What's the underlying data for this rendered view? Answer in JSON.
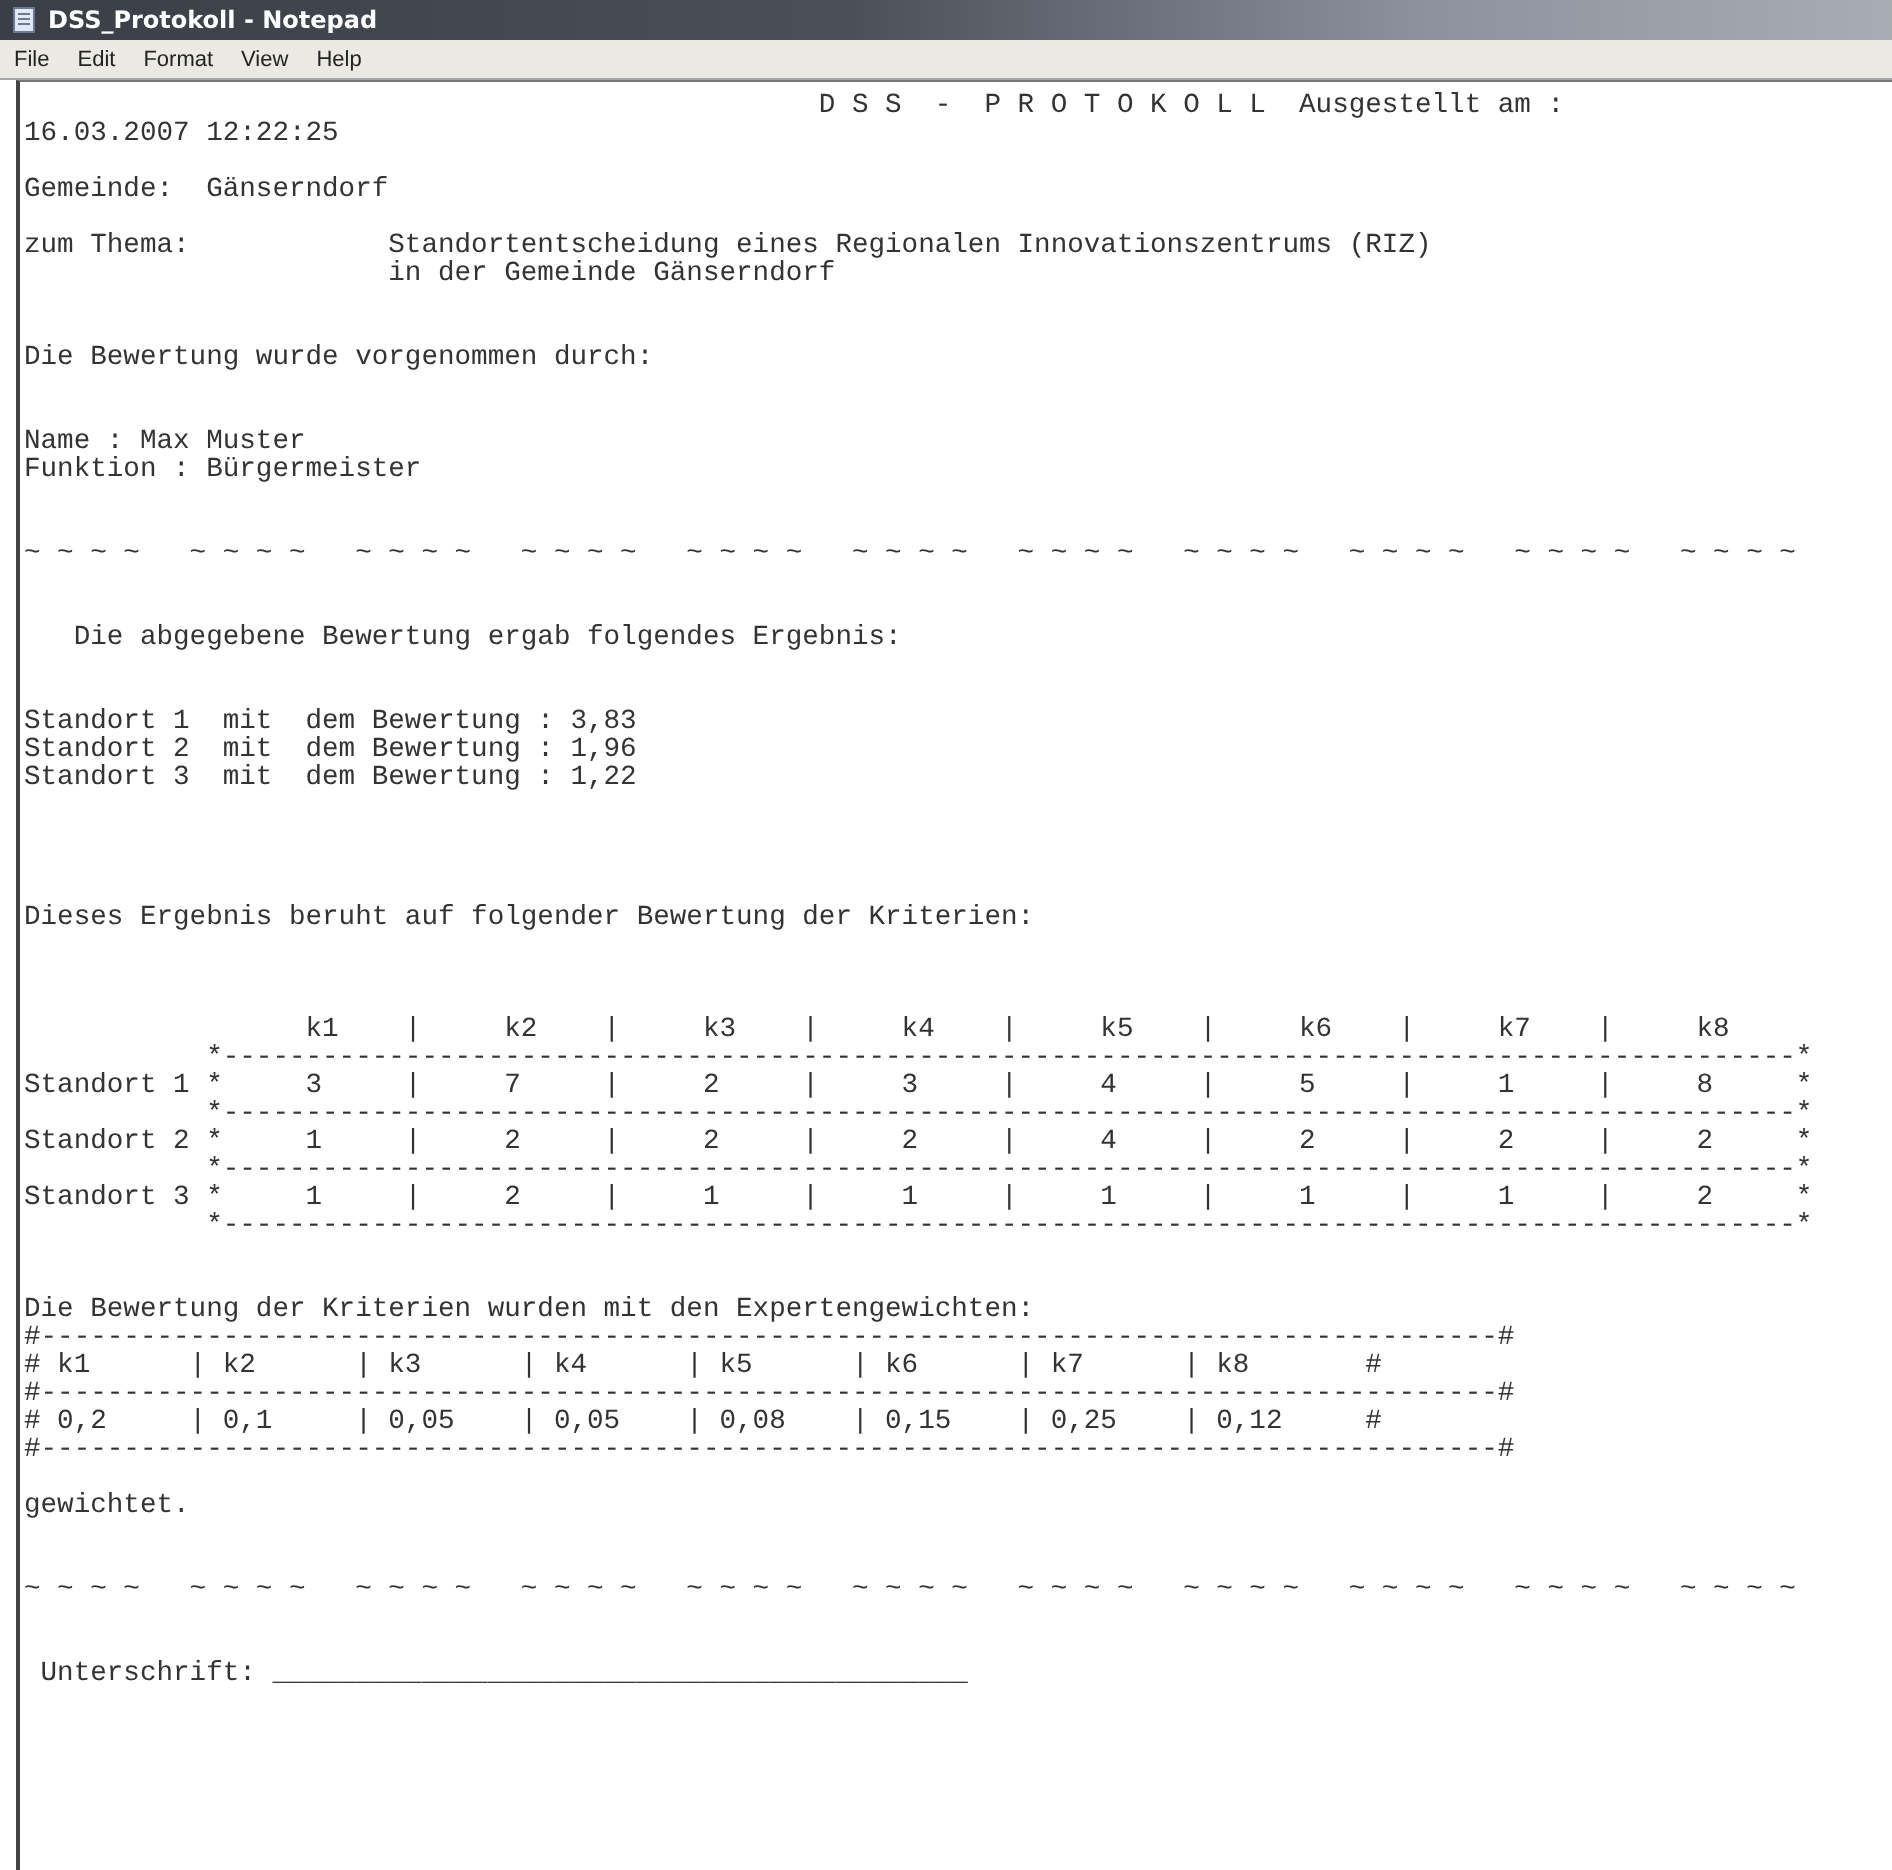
{
  "window": {
    "title": "DSS_Protokoll - Notepad"
  },
  "menu": [
    "File",
    "Edit",
    "Format",
    "View",
    "Help"
  ],
  "document": {
    "text": "                                                D S S  -  P R O T O K O L L  Ausgestellt am :\n16.03.2007 12:22:25\n\nGemeinde:  Gänserndorf\n\nzum Thema:            Standortentscheidung eines Regionalen Innovationszentrums (RIZ)\n                      in der Gemeinde Gänserndorf\n\n\nDie Bewertung wurde vorgenommen durch:\n\n\nName : Max Muster\nFunktion : Bürgermeister\n\n\n~ ~ ~ ~   ~ ~ ~ ~   ~ ~ ~ ~   ~ ~ ~ ~   ~ ~ ~ ~   ~ ~ ~ ~   ~ ~ ~ ~   ~ ~ ~ ~   ~ ~ ~ ~   ~ ~ ~ ~   ~ ~ ~ ~\n\n\n   Die abgegebene Bewertung ergab folgendes Ergebnis:\n\n\nStandort 1  mit  dem Bewertung : 3,83\nStandort 2  mit  dem Bewertung : 1,96\nStandort 3  mit  dem Bewertung : 1,22\n\n\n\n\nDieses Ergebnis beruht auf folgender Bewertung der Kriterien:\n\n\n\n                 k1    |     k2    |     k3    |     k4    |     k5    |     k6    |     k7    |     k8\n           *-----------------------------------------------------------------------------------------------*\nStandort 1 *     3     |     7     |     2     |     3     |     4     |     5     |     1     |     8     *\n           *-----------------------------------------------------------------------------------------------*\nStandort 2 *     1     |     2     |     2     |     2     |     4     |     2     |     2     |     2     *\n           *-----------------------------------------------------------------------------------------------*\nStandort 3 *     1     |     2     |     1     |     1     |     1     |     1     |     1     |     2     *\n           *-----------------------------------------------------------------------------------------------*\n\n\nDie Bewertung der Kriterien wurden mit den Expertengewichten:\n#----------------------------------------------------------------------------------------#\n# k1      | k2      | k3      | k4      | k5      | k6      | k7      | k8       #\n#----------------------------------------------------------------------------------------#\n# 0,2     | 0,1     | 0,05    | 0,05    | 0,08    | 0,15    | 0,25    | 0,12     #\n#----------------------------------------------------------------------------------------#\n\ngewichtet.\n\n\n~ ~ ~ ~   ~ ~ ~ ~   ~ ~ ~ ~   ~ ~ ~ ~   ~ ~ ~ ~   ~ ~ ~ ~   ~ ~ ~ ~   ~ ~ ~ ~   ~ ~ ~ ~   ~ ~ ~ ~   ~ ~ ~ ~\n\n\n Unterschrift: __________________________________________"
  }
}
